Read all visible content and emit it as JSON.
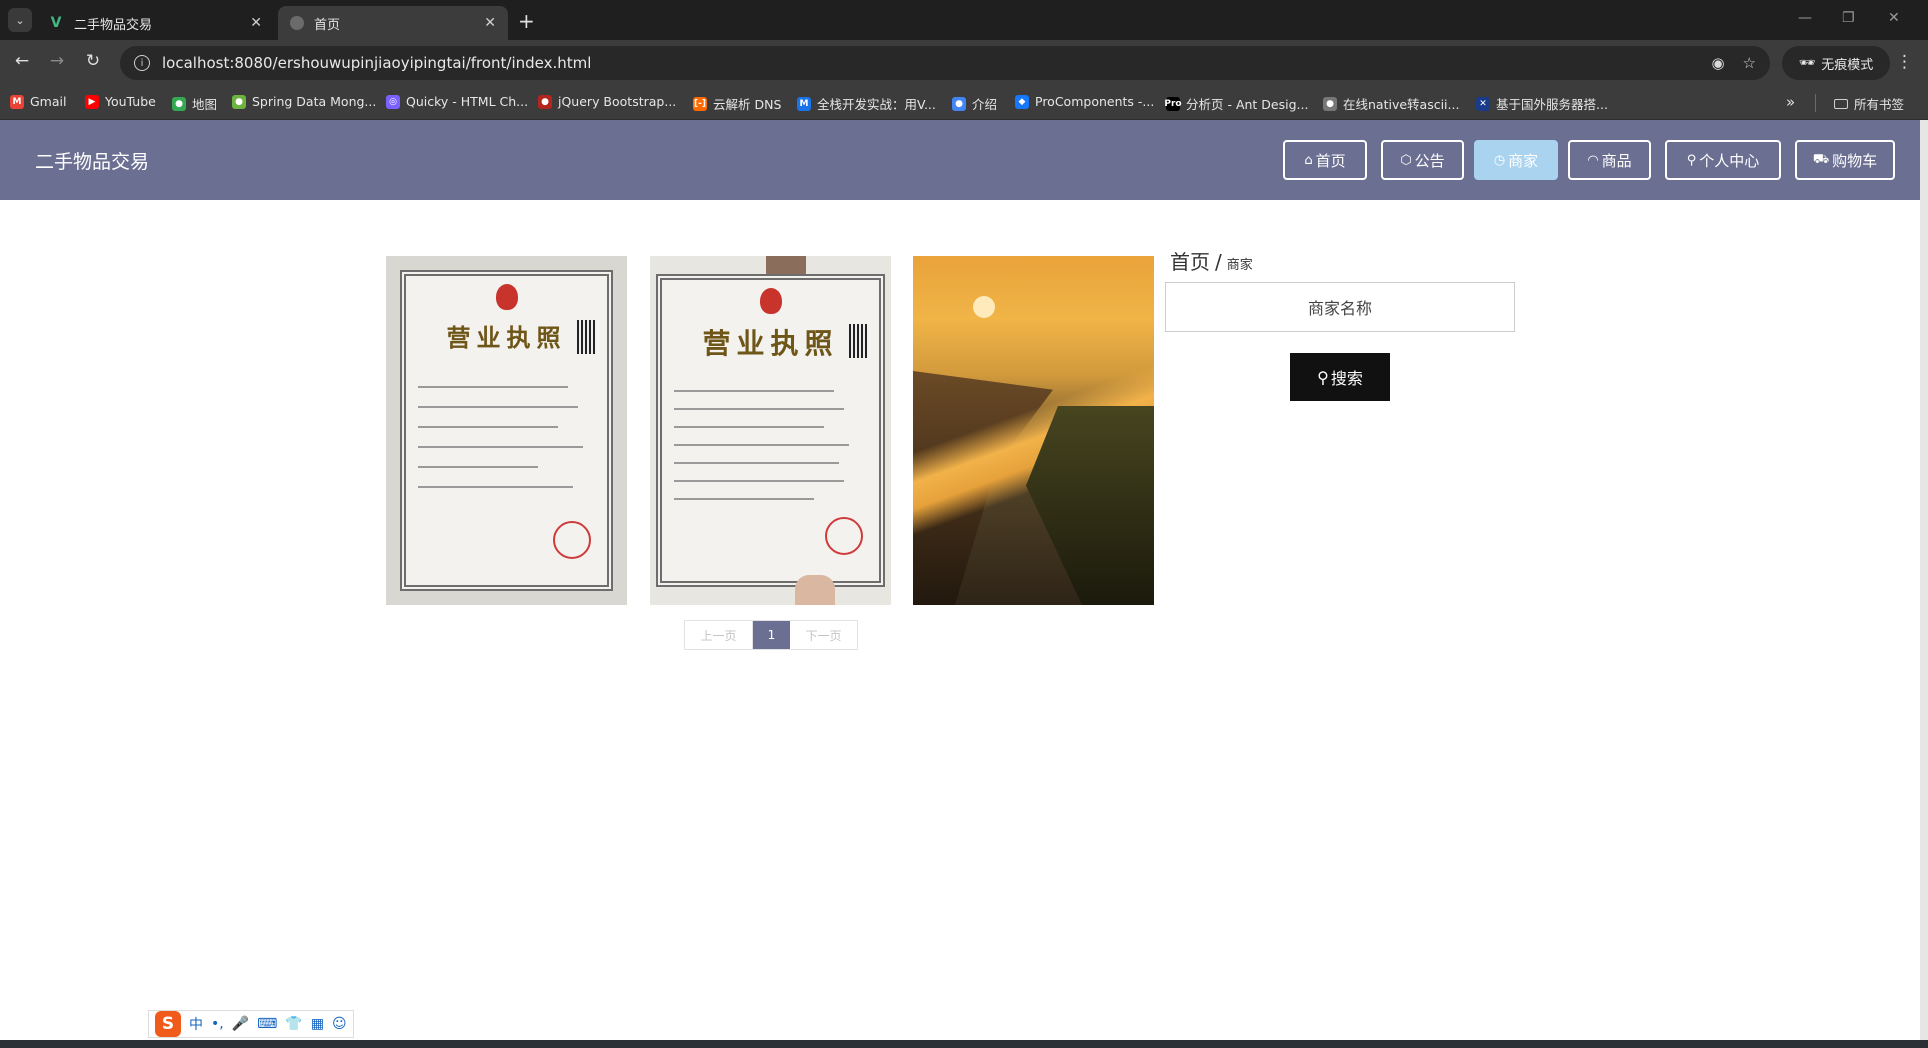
{
  "browser": {
    "tabs": [
      {
        "title": "二手物品交易",
        "active": false
      },
      {
        "title": "首页",
        "active": true
      }
    ],
    "url": "localhost:8080/ershouwupinjiaoyipingtai/front/index.html",
    "incognito_label": "无痕模式",
    "bookmarks": [
      {
        "label": "Gmail",
        "color": "#ea4335",
        "glyph": "M"
      },
      {
        "label": "YouTube",
        "color": "#ff0000",
        "glyph": "▶"
      },
      {
        "label": "地图",
        "color": "#34a853",
        "glyph": "●"
      },
      {
        "label": "Spring Data Mong...",
        "color": "#6db33f",
        "glyph": "●"
      },
      {
        "label": "Quicky - HTML Ch...",
        "color": "#7b61ff",
        "glyph": "◎"
      },
      {
        "label": "jQuery Bootstrap...",
        "color": "#b3261e",
        "glyph": "●"
      },
      {
        "label": "云解析 DNS",
        "color": "#ff6a00",
        "glyph": "[-]"
      },
      {
        "label": "全栈开发实战：用V...",
        "color": "#1a73e8",
        "glyph": "M"
      },
      {
        "label": "介绍",
        "color": "#4285f4",
        "glyph": "●"
      },
      {
        "label": "ProComponents -...",
        "color": "#1677ff",
        "glyph": "◆"
      },
      {
        "label": "分析页 - Ant Desig...",
        "color": "#000000",
        "glyph": "Pro"
      },
      {
        "label": "在线native转ascii...",
        "color": "#777777",
        "glyph": "●"
      },
      {
        "label": "基于国外服务器搭...",
        "color": "#1a3a8a",
        "glyph": "✕"
      }
    ],
    "all_bookmarks_label": "所有书签"
  },
  "header": {
    "site_title": "二手物品交易",
    "nav": [
      {
        "label": "首页",
        "icon": "home-icon",
        "glyph": "⌂",
        "active": false
      },
      {
        "label": "公告",
        "icon": "cube-icon",
        "glyph": "⬡",
        "active": false
      },
      {
        "label": "商家",
        "icon": "clock-icon",
        "glyph": "◷",
        "active": true
      },
      {
        "label": "商品",
        "icon": "gauge-icon",
        "glyph": "◠",
        "active": false
      },
      {
        "label": "个人中心",
        "icon": "user-icon",
        "glyph": "⚲",
        "active": false
      },
      {
        "label": "购物车",
        "icon": "cart-icon",
        "glyph": "⛟",
        "active": false
      }
    ]
  },
  "main": {
    "breadcrumb": {
      "home": "首页",
      "separator": "/",
      "current": "商家"
    },
    "search": {
      "placeholder": "商家名称",
      "button_label": "搜索",
      "button_icon": "search-icon"
    },
    "cards": [
      {
        "name": "merchant-image-business-license-1",
        "lettering": "营业执照"
      },
      {
        "name": "merchant-image-business-license-2",
        "lettering": "营业执照"
      },
      {
        "name": "merchant-image-river-landscape"
      }
    ],
    "pagination": {
      "prev": "上一页",
      "current": "1",
      "next": "下一页"
    }
  },
  "ime": {
    "logo": "S",
    "items": [
      "中",
      "•,",
      "🎤",
      "⌨",
      "👕",
      "▦",
      "☺"
    ]
  }
}
